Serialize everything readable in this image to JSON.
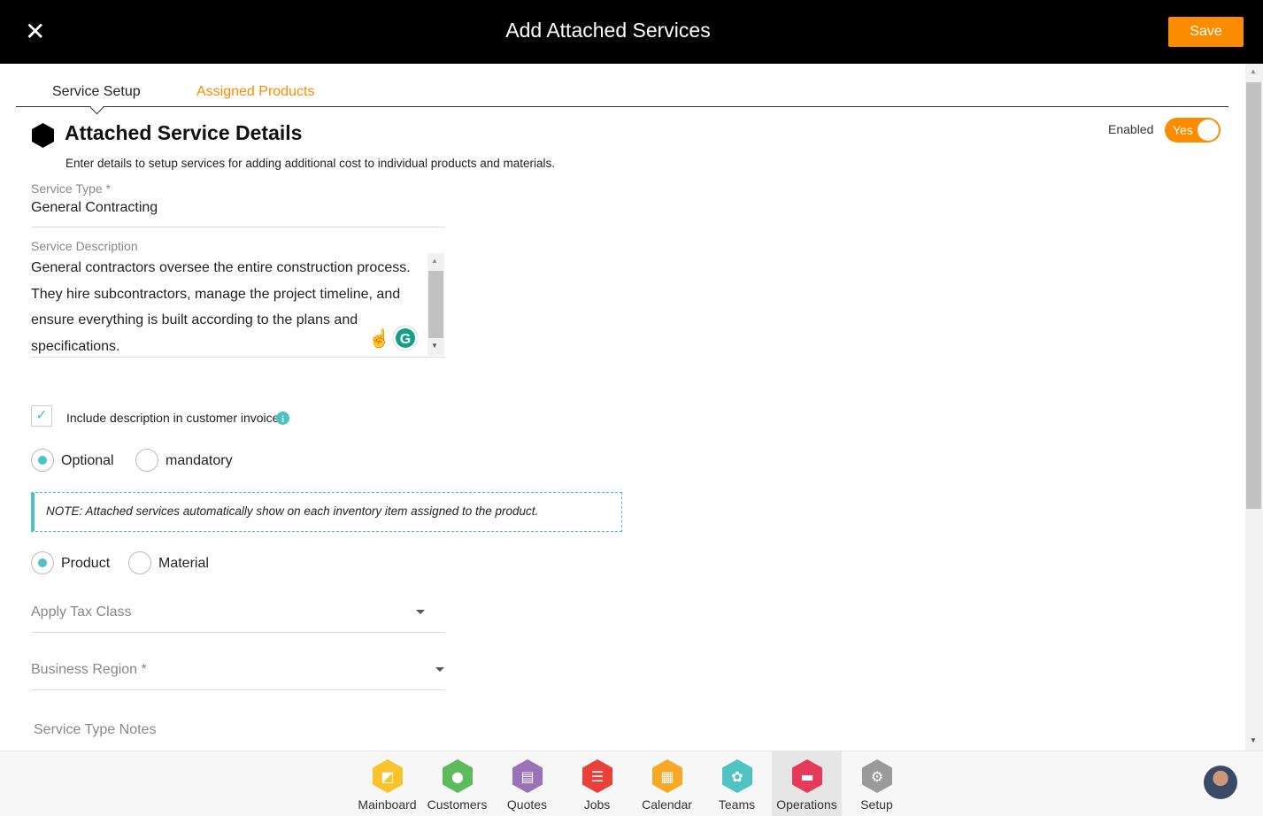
{
  "header": {
    "title": "Add Attached Services",
    "save_label": "Save",
    "close_icon": "close-icon"
  },
  "tabs": [
    {
      "label": "Service Setup",
      "active": true
    },
    {
      "label": "Assigned Products",
      "active": false
    }
  ],
  "section": {
    "title": "Attached Service Details",
    "subtitle": "Enter details to setup services for adding additional cost to individual products and materials.",
    "enabled_label": "Enabled",
    "toggle_label": "Yes",
    "toggle_on": true
  },
  "form": {
    "service_type_label": "Service Type *",
    "service_type_value": "General Contracting",
    "description_label": "Service Description",
    "description_value": "General contractors oversee the entire construction process. They hire subcontractors, manage the project timeline, and ensure everything is built according to the plans and specifications.",
    "include_desc_label": "Include description in customer invoice",
    "include_desc_checked": true,
    "requirement_options": [
      "Optional",
      "mandatory"
    ],
    "requirement_selected": "Optional",
    "note": "NOTE: Attached services automatically show on each inventory item assigned to the product.",
    "item_options": [
      "Product",
      "Material"
    ],
    "item_selected": "Product",
    "tax_class_placeholder": "Apply Tax Class",
    "business_region_placeholder": "Business Region *",
    "notes_label": "Service Type Notes"
  },
  "nav": {
    "items": [
      {
        "label": "Mainboard",
        "color": "#f9c32b"
      },
      {
        "label": "Customers",
        "color": "#5dbb5d"
      },
      {
        "label": "Quotes",
        "color": "#9a72b8"
      },
      {
        "label": "Jobs",
        "color": "#e8413a"
      },
      {
        "label": "Calendar",
        "color": "#f6a925"
      },
      {
        "label": "Teams",
        "color": "#4fc2c2"
      },
      {
        "label": "Operations",
        "color": "#e63a5a",
        "active": true
      },
      {
        "label": "Setup",
        "color": "#9a9a9a"
      }
    ]
  },
  "colors": {
    "accent": "#fb8c00",
    "teal": "#4dc2c2"
  }
}
